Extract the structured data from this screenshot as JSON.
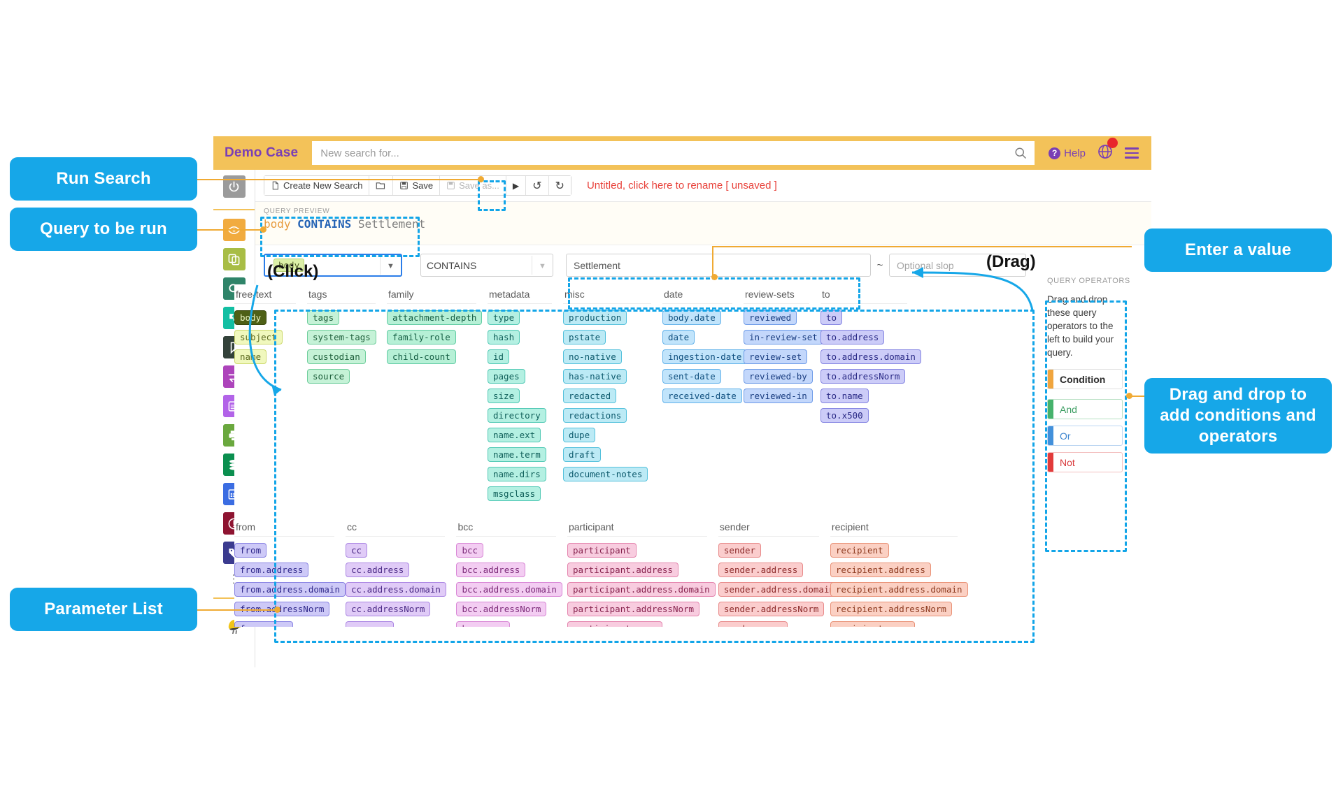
{
  "header": {
    "case_name": "Demo Case",
    "search_placeholder": "New search for...",
    "help_label": "Help",
    "search_icon": "search-icon",
    "globe_icon": "globe-icon",
    "menu_icon": "hamburger-menu-icon"
  },
  "toolbar": {
    "create_new_search": "Create New Search",
    "open_label": "",
    "save": "Save",
    "save_as": "Save as...",
    "run": "▶",
    "undo": "↺",
    "redo": "↻",
    "status_text": "Untitled, click here to rename [ unsaved ]"
  },
  "query_preview": {
    "label": "QUERY PREVIEW",
    "field": "body",
    "operator": "CONTAINS",
    "value": "Settlement"
  },
  "condition_row": {
    "field_chip": "body",
    "operator_value": "CONTAINS",
    "value_text": "Settlement",
    "tilde": "~",
    "slop_placeholder": "Optional slop"
  },
  "sidebar": {
    "items": [
      {
        "name": "power-icon",
        "color": "#9b9b9b"
      },
      {
        "name": "eye-icon",
        "color": "#f1ab3f"
      },
      {
        "name": "copy-documents-icon",
        "color": "#a8bd45"
      },
      {
        "name": "search-icon",
        "color": "#2f8469"
      },
      {
        "name": "puzzle-icon",
        "color": "#13bfa3"
      },
      {
        "name": "bookmark-icon",
        "color": "#33423a"
      },
      {
        "name": "transfer-arrows-icon",
        "color": "#ad44bb"
      },
      {
        "name": "list-panel-icon",
        "color": "#b263e8"
      },
      {
        "name": "printer-icon",
        "color": "#6aa83e"
      },
      {
        "name": "database-icon",
        "color": "#0b8f4f"
      },
      {
        "name": "grid-table-icon",
        "color": "#3b6de2"
      },
      {
        "name": "alert-icon",
        "color": "#8e1431"
      },
      {
        "name": "tags-icon",
        "color": "#3b3b8f"
      }
    ],
    "more_dots": "⋮",
    "bird_icon": "🐦"
  },
  "parameters": {
    "groups_top": [
      {
        "title": "free-text",
        "class": "c-freetext",
        "items": [
          "body",
          "subject",
          "name"
        ],
        "selected": "body"
      },
      {
        "title": "tags",
        "class": "c-tags",
        "items": [
          "tags",
          "system-tags",
          "custodian",
          "source"
        ]
      },
      {
        "title": "family",
        "class": "c-family",
        "items": [
          "attachment-depth",
          "family-role",
          "child-count"
        ]
      },
      {
        "title": "metadata",
        "class": "c-metadata",
        "items": [
          "type",
          "hash",
          "id",
          "pages",
          "size",
          "directory",
          "name.ext",
          "name.term",
          "name.dirs",
          "msgclass"
        ]
      },
      {
        "title": "misc",
        "class": "c-misc",
        "items": [
          "production",
          "pstate",
          "no-native",
          "has-native",
          "redacted",
          "redactions",
          "dupe",
          "draft",
          "document-notes"
        ]
      },
      {
        "title": "date",
        "class": "c-date",
        "items": [
          "body.date",
          "date",
          "ingestion-date",
          "sent-date",
          "received-date"
        ]
      },
      {
        "title": "review-sets",
        "class": "c-review",
        "items": [
          "reviewed",
          "in-review-set",
          "review-set",
          "reviewed-by",
          "reviewed-in"
        ]
      },
      {
        "title": "to",
        "class": "c-to",
        "items": [
          "to",
          "to.address",
          "to.address.domain",
          "to.addressNorm",
          "to.name",
          "to.x500"
        ]
      }
    ],
    "groups_bottom": [
      {
        "title": "from",
        "class": "c-from",
        "items": [
          "from",
          "from.address",
          "from.address.domain",
          "from.addressNorm",
          "from.name"
        ]
      },
      {
        "title": "cc",
        "class": "c-cc",
        "items": [
          "cc",
          "cc.address",
          "cc.address.domain",
          "cc.addressNorm",
          "cc.name"
        ]
      },
      {
        "title": "bcc",
        "class": "c-bcc",
        "items": [
          "bcc",
          "bcc.address",
          "bcc.address.domain",
          "bcc.addressNorm",
          "bcc.name"
        ]
      },
      {
        "title": "participant",
        "class": "c-participant",
        "items": [
          "participant",
          "participant.address",
          "participant.address.domain",
          "participant.addressNorm",
          "participant.name"
        ]
      },
      {
        "title": "sender",
        "class": "c-sender",
        "items": [
          "sender",
          "sender.address",
          "sender.address.domain",
          "sender.addressNorm",
          "sender.name"
        ]
      },
      {
        "title": "recipient",
        "class": "c-recipient",
        "items": [
          "recipient",
          "recipient.address",
          "recipient.address.domain",
          "recipient.addressNorm",
          "recipient.name"
        ]
      }
    ]
  },
  "query_operators": {
    "title": "QUERY OPERATORS",
    "description": "Drag and drop these query operators to the left to build your query.",
    "buttons": [
      {
        "label": "Condition",
        "class": "op-condition"
      },
      {
        "label": "And",
        "class": "op-and"
      },
      {
        "label": "Or",
        "class": "op-or"
      },
      {
        "label": "Not",
        "class": "op-not"
      }
    ]
  },
  "annotations": {
    "run_search": "Run Search",
    "query_to_be_run": "Query to be run",
    "enter_a_value": "Enter a value",
    "drag_drop_conditions": "Drag and drop to add conditions and operators",
    "parameter_list": "Parameter List",
    "click_hint": "(Click)",
    "drag_hint": "(Drag)",
    "accent_color": "#16a7e8",
    "leader_color": "#f0aa33"
  }
}
